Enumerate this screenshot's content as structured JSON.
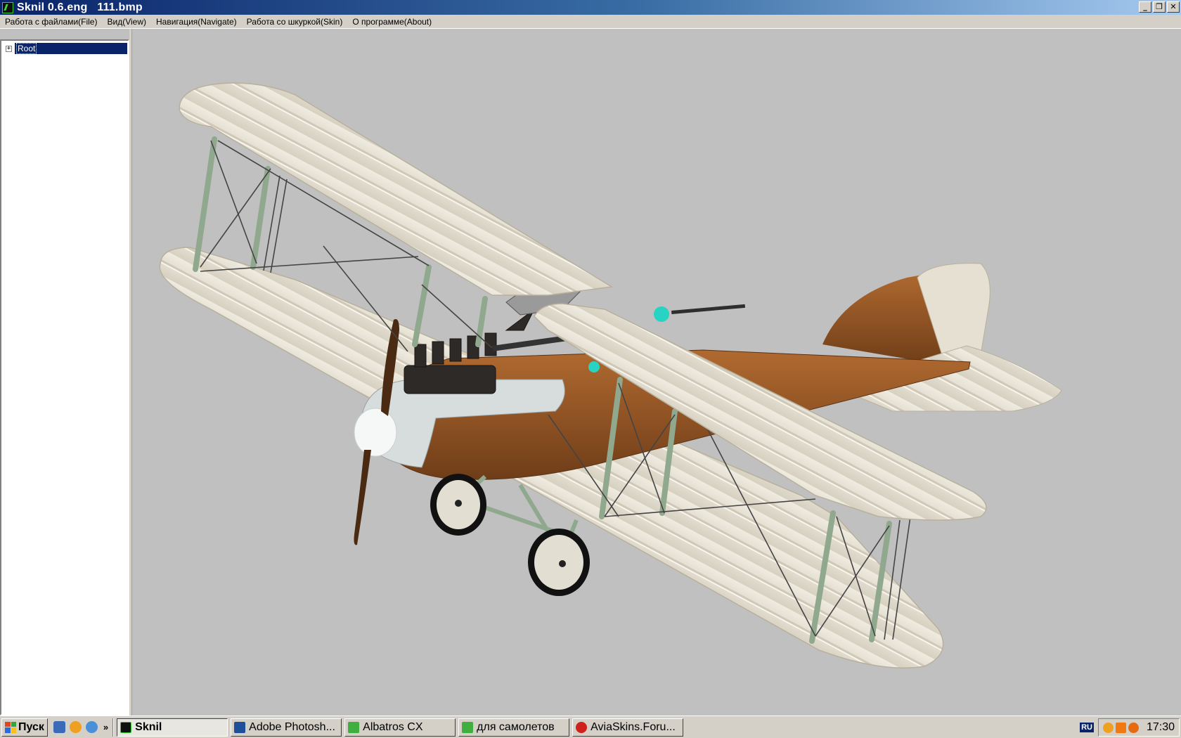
{
  "window": {
    "title": "Sknil 0.6.eng   111.bmp",
    "buttons": {
      "minimize": "_",
      "restore": "❐",
      "close": "✕"
    }
  },
  "menu": [
    "Работа с файлами(File)",
    "Вид(View)",
    "Навигация(Navigate)",
    "Работа со шкуркой(Skin)",
    "О программе(About)"
  ],
  "tree": {
    "expand": "+",
    "root_label": "Root"
  },
  "viewport": {
    "background": "#c0c0c0",
    "model": "biplane-3d-model"
  },
  "taskbar": {
    "start_label": "Пуск",
    "quicklaunch_more": "»",
    "tasks": [
      {
        "label": "Sknil",
        "icon": "sknil-icon",
        "active": true
      },
      {
        "label": "Adobe Photosh...",
        "icon": "photoshop-icon",
        "active": false
      },
      {
        "label": "Albatros CX",
        "icon": "folder-icon",
        "active": false
      },
      {
        "label": "для самолетов",
        "icon": "folder-icon",
        "active": false
      },
      {
        "label": "AviaSkins.Foru...",
        "icon": "opera-icon",
        "active": false
      }
    ],
    "language": "RU",
    "clock": "17:30"
  }
}
